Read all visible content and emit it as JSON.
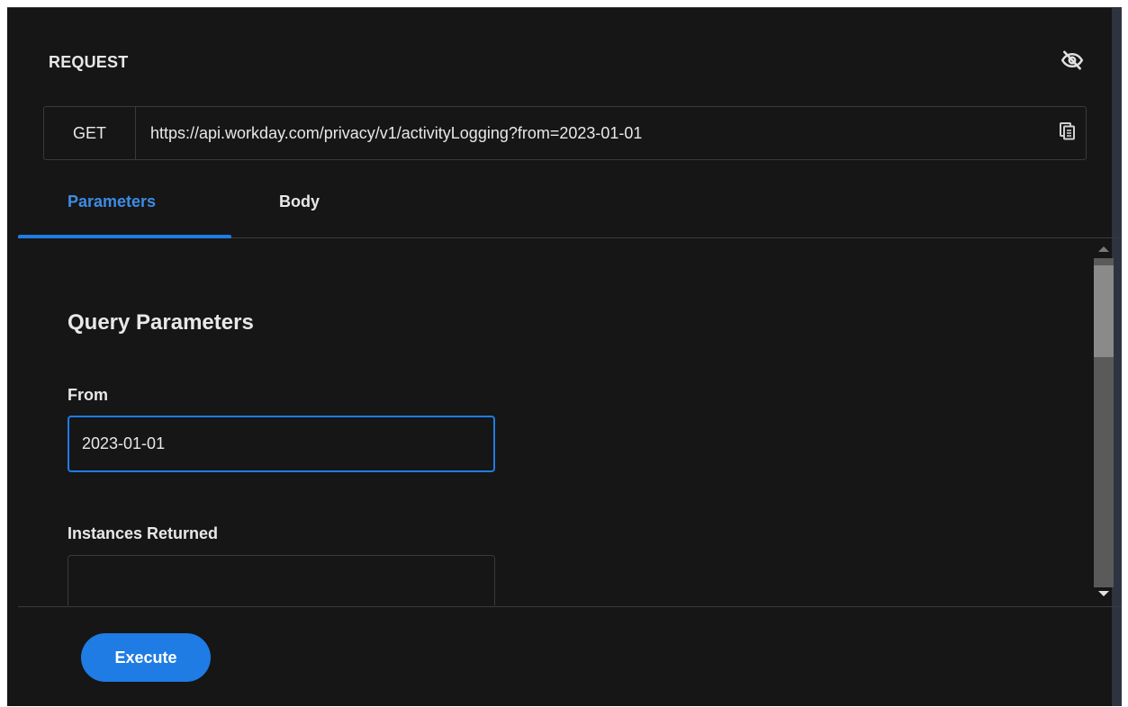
{
  "request": {
    "title": "REQUEST",
    "visibility_icon": "eye-off-icon",
    "method": "GET",
    "url": "https://api.workday.com/privacy/v1/activityLogging?from=2023-01-01",
    "copy_icon": "copy-icon"
  },
  "tabs": [
    {
      "label": "Parameters",
      "active": true
    },
    {
      "label": "Body",
      "active": false
    }
  ],
  "query_parameters": {
    "title": "Query Parameters",
    "from_label": "From",
    "from_value": "2023-01-01",
    "instances_label": "Instances Returned",
    "instances_value": ""
  },
  "footer": {
    "execute_label": "Execute"
  },
  "colors": {
    "accent": "#1e7ce4",
    "active_tab_text": "#3d8ce6",
    "background": "#161616",
    "text": "#e8e8e8"
  }
}
